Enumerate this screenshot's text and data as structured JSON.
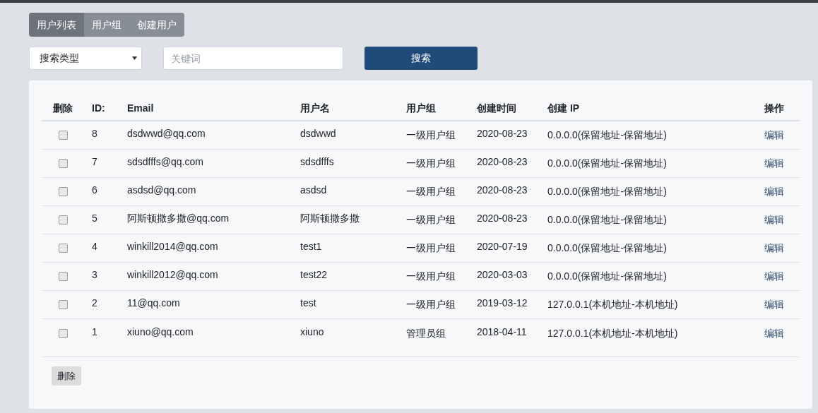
{
  "tabs": [
    {
      "label": "用户列表",
      "selected": true
    },
    {
      "label": "用户组",
      "selected": false
    },
    {
      "label": "创建用户",
      "selected": false
    }
  ],
  "search": {
    "type_select": "搜索类型",
    "keyword_placeholder": "关键词",
    "button": "搜索"
  },
  "table": {
    "columns": [
      "删除",
      "ID:",
      "Email",
      "用户名",
      "用户组",
      "创建时间",
      "创建 IP",
      "操作"
    ],
    "rows": [
      {
        "checked": false,
        "id": "8",
        "email": "dsdwwd@qq.com",
        "username": "dsdwwd",
        "group": "一级用户组",
        "created": "2020-08-23",
        "ip": "0.0.0.0(保留地址-保留地址)",
        "action": "编辑"
      },
      {
        "checked": false,
        "id": "7",
        "email": "sdsdfffs@qq.com",
        "username": "sdsdfffs",
        "group": "一级用户组",
        "created": "2020-08-23",
        "ip": "0.0.0.0(保留地址-保留地址)",
        "action": "编辑"
      },
      {
        "checked": false,
        "id": "6",
        "email": "asdsd@qq.com",
        "username": "asdsd",
        "group": "一级用户组",
        "created": "2020-08-23",
        "ip": "0.0.0.0(保留地址-保留地址)",
        "action": "编辑"
      },
      {
        "checked": false,
        "id": "5",
        "email": "阿斯顿撒多撒@qq.com",
        "username": "阿斯顿撒多撒",
        "group": "一级用户组",
        "created": "2020-08-23",
        "ip": "0.0.0.0(保留地址-保留地址)",
        "action": "编辑"
      },
      {
        "checked": false,
        "id": "4",
        "email": "winkill2014@qq.com",
        "username": "test1",
        "group": "一级用户组",
        "created": "2020-07-19",
        "ip": "0.0.0.0(保留地址-保留地址)",
        "action": "编辑"
      },
      {
        "checked": false,
        "id": "3",
        "email": "winkill2012@qq.com",
        "username": "test22",
        "group": "一级用户组",
        "created": "2020-03-03",
        "ip": "0.0.0.0(保留地址-保留地址)",
        "action": "编辑"
      },
      {
        "checked": false,
        "id": "2",
        "email": "11@qq.com",
        "username": "test",
        "group": "一级用户组",
        "created": "2019-03-12",
        "ip": "127.0.0.1(本机地址-本机地址)",
        "action": "编辑"
      },
      {
        "checked": false,
        "id": "1",
        "email": "xiuno@qq.com",
        "username": "xiuno",
        "group": "管理员组",
        "created": "2018-04-11",
        "ip": "127.0.0.1(本机地址-本机地址)",
        "action": "编辑"
      }
    ]
  },
  "delete_button": "删除"
}
